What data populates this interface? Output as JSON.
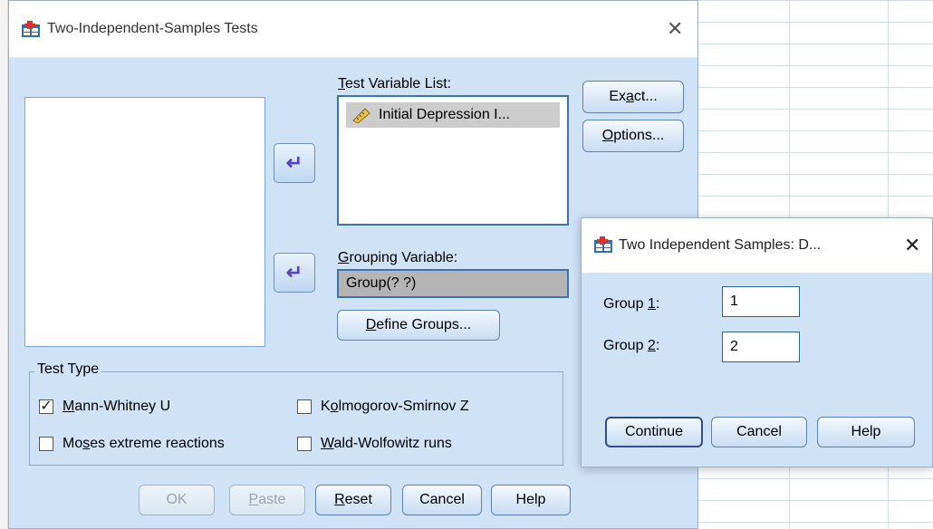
{
  "main_dialog": {
    "title": "Two-Independent-Samples Tests",
    "close_glyph": "✕",
    "test_variable_list_label_pre": "",
    "test_variable_list_label_u": "T",
    "test_variable_list_label_post": "est Variable List:",
    "test_variables": [
      {
        "name": "Initial Depression I...",
        "icon": "scale-ruler-icon"
      }
    ],
    "grouping_variable_label_pre": "",
    "grouping_variable_label_u": "G",
    "grouping_variable_label_post": "rouping Variable:",
    "grouping_variable_value": "Group(? ?)",
    "define_groups_pre": "",
    "define_groups_u": "D",
    "define_groups_post": "efine Groups...",
    "exact_pre": "Ex",
    "exact_u": "a",
    "exact_post": "ct...",
    "options_pre": "",
    "options_u": "O",
    "options_post": "ptions...",
    "test_type": {
      "legend": "Test Type",
      "mann_whitney": {
        "pre": "",
        "u": "M",
        "post": "ann-Whitney U",
        "checked": true
      },
      "kolmogorov": {
        "pre": "K",
        "u": "o",
        "post": "lmogorov-Smirnov Z",
        "checked": false
      },
      "moses": {
        "pre": "Mo",
        "u": "s",
        "post": "es extreme reactions",
        "checked": false
      },
      "wald": {
        "pre": "",
        "u": "W",
        "post": "ald-Wolfowitz runs",
        "checked": false
      }
    },
    "buttons": {
      "ok": "OK",
      "paste_u": "P",
      "paste_post": "aste",
      "reset_u": "R",
      "reset_post": "eset",
      "cancel": "Cancel",
      "help": "Help"
    }
  },
  "define_dialog": {
    "title": "Two Independent Samples: D...",
    "close_glyph": "✕",
    "group1_label_pre": "Group ",
    "group1_label_u": "1",
    "group1_label_post": ":",
    "group1_value": "1",
    "group2_label_pre": "Group ",
    "group2_label_u": "2",
    "group2_label_post": ":",
    "group2_value": "2",
    "buttons": {
      "continue": "Continue",
      "cancel": "Cancel",
      "help": "Help"
    }
  },
  "colors": {
    "dialog_bg": "#cfe2f6",
    "arrow": "#5b3fc3",
    "selection": "#cccccc"
  }
}
